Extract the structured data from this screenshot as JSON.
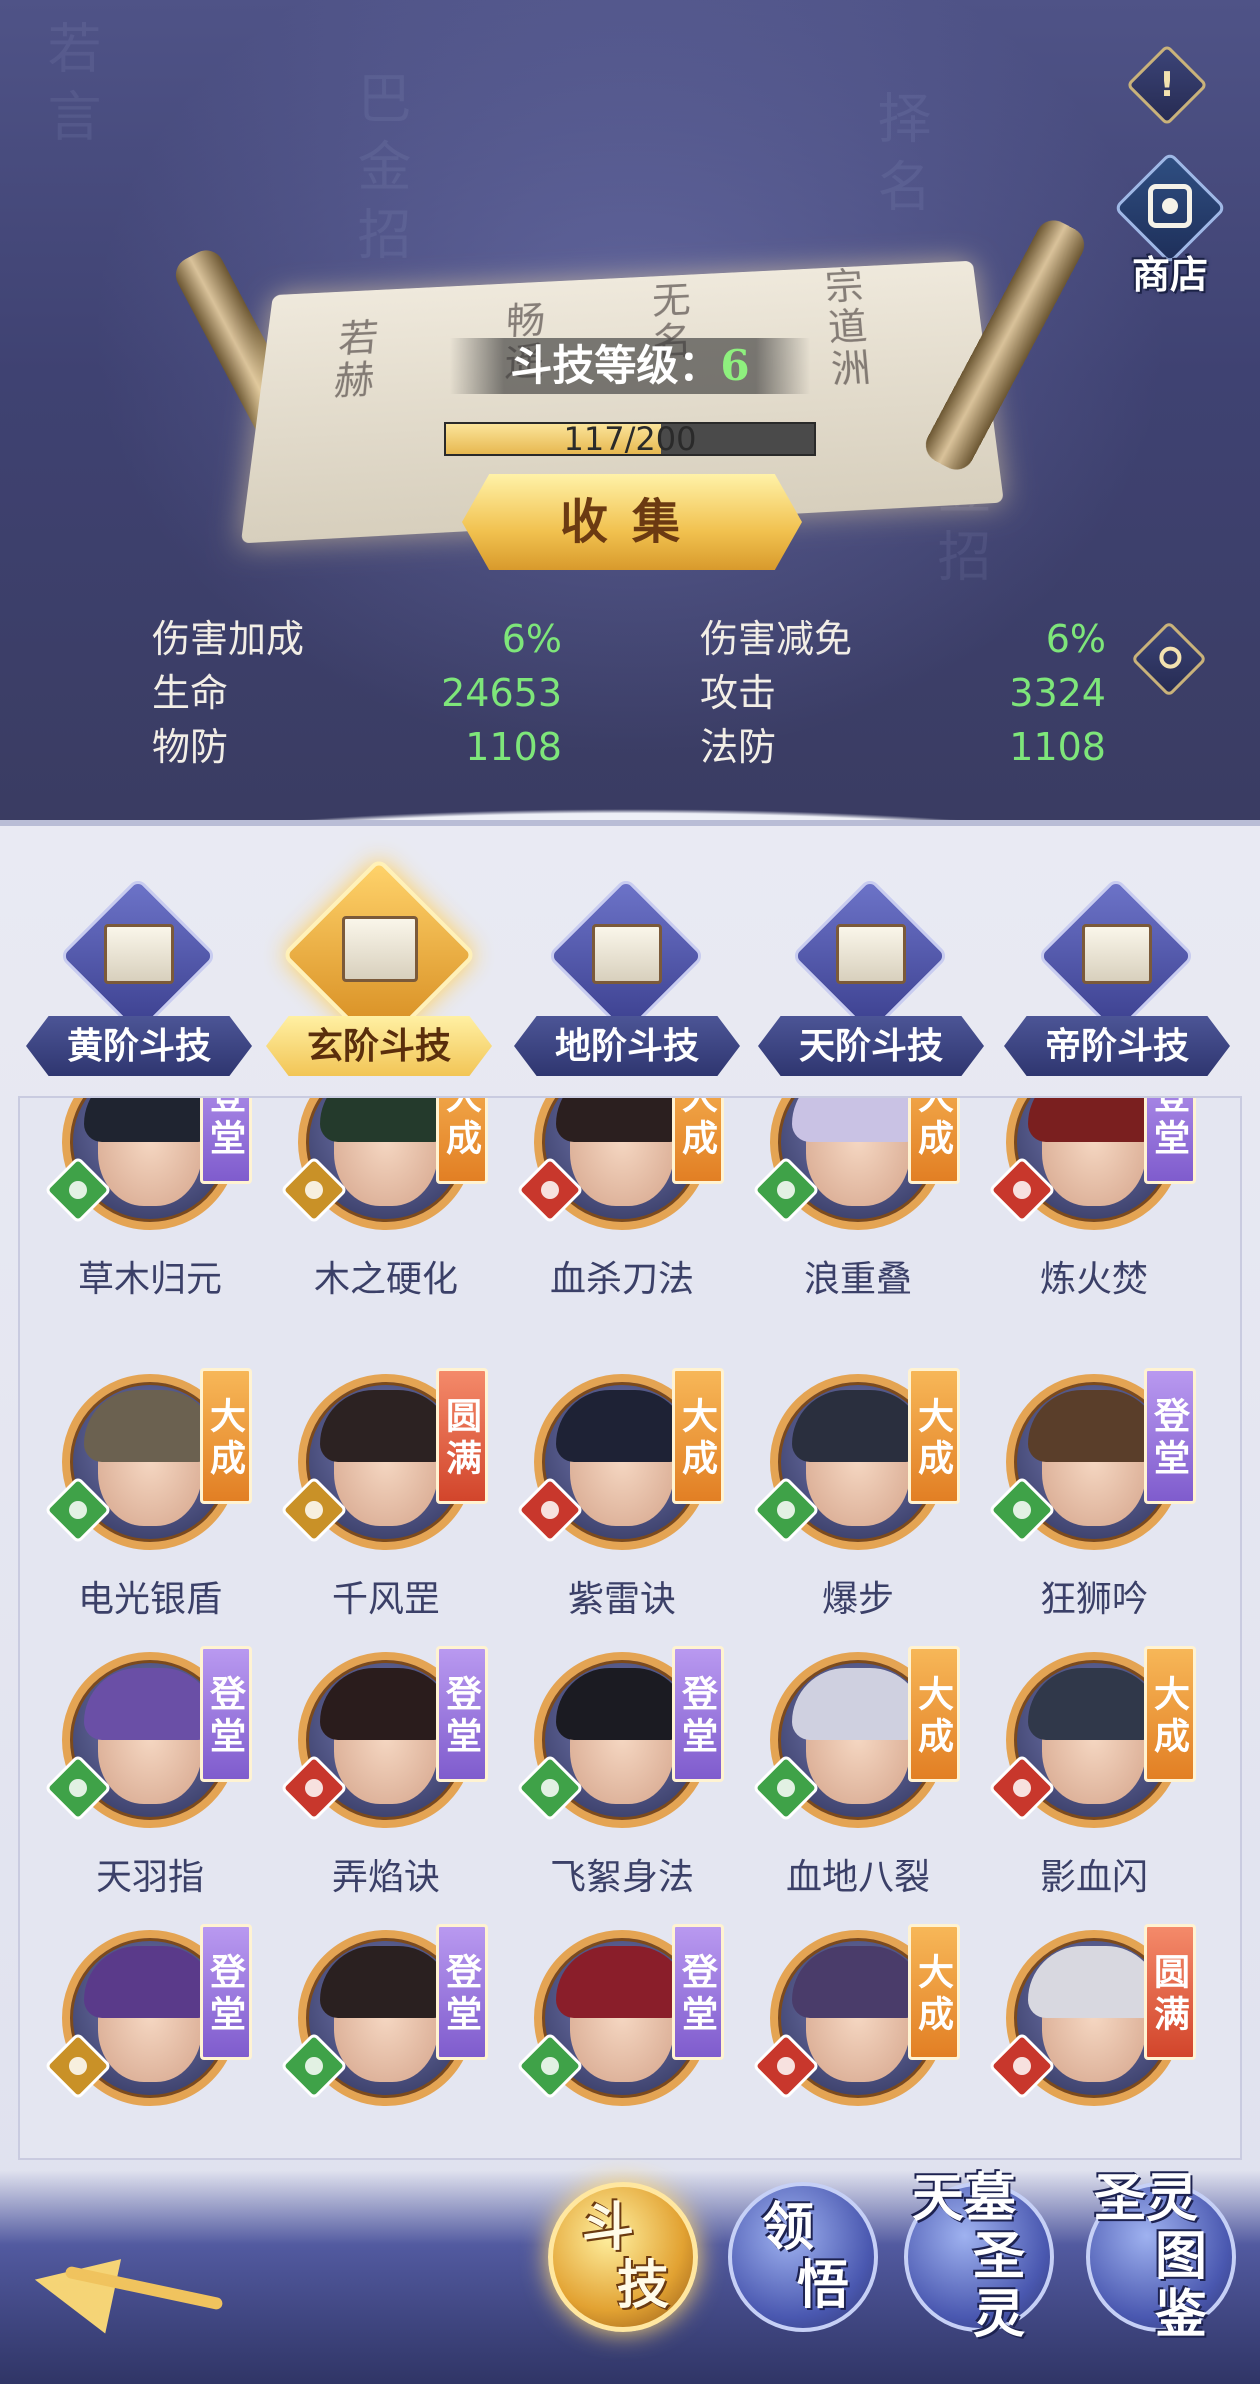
{
  "header": {
    "info_icon": "!",
    "shop_label": "商店"
  },
  "scroll": {
    "level_label": "斗技等级：",
    "level_value": "6",
    "exp_text": "117/200",
    "exp_fraction": 0.585,
    "collect_label": "收集"
  },
  "stats": {
    "damage_bonus": {
      "label": "伤害加成",
      "value": "6%"
    },
    "damage_reduction": {
      "label": "伤害减免",
      "value": "6%"
    },
    "hp": {
      "label": "生命",
      "value": "24653"
    },
    "attack": {
      "label": "攻击",
      "value": "3324"
    },
    "physical_def": {
      "label": "物防",
      "value": "1108"
    },
    "magic_def": {
      "label": "法防",
      "value": "1108"
    }
  },
  "tabs": [
    {
      "label": "黄阶斗技",
      "active": false
    },
    {
      "label": "玄阶斗技",
      "active": true
    },
    {
      "label": "地阶斗技",
      "active": false
    },
    {
      "label": "天阶斗技",
      "active": false
    },
    {
      "label": "帝阶斗技",
      "active": false
    }
  ],
  "skills": [
    {
      "name": "草木归元",
      "badge": "登堂",
      "element": "wood"
    },
    {
      "name": "木之硬化",
      "badge": "大成",
      "element": "gold"
    },
    {
      "name": "血杀刀法",
      "badge": "大成",
      "element": "fire"
    },
    {
      "name": "浪重叠",
      "badge": "大成",
      "element": "wood"
    },
    {
      "name": "炼火焚",
      "badge": "登堂",
      "element": "fire"
    },
    {
      "name": "电光银盾",
      "badge": "大成",
      "element": "wood"
    },
    {
      "name": "千风罡",
      "badge": "圆满",
      "element": "gold"
    },
    {
      "name": "紫雷诀",
      "badge": "大成",
      "element": "fire"
    },
    {
      "name": "爆步",
      "badge": "大成",
      "element": "wood"
    },
    {
      "name": "狂狮吟",
      "badge": "登堂",
      "element": "wood"
    },
    {
      "name": "天羽指",
      "badge": "登堂",
      "element": "wood"
    },
    {
      "name": "弄焰诀",
      "badge": "登堂",
      "element": "fire"
    },
    {
      "name": "飞絮身法",
      "badge": "登堂",
      "element": "wood"
    },
    {
      "name": "血地八裂",
      "badge": "大成",
      "element": "wood"
    },
    {
      "name": "影血闪",
      "badge": "大成",
      "element": "fire"
    },
    {
      "name": "",
      "badge": "登堂",
      "element": "gold"
    },
    {
      "name": "",
      "badge": "登堂",
      "element": "wood"
    },
    {
      "name": "",
      "badge": "登堂",
      "element": "wood"
    },
    {
      "name": "",
      "badge": "大成",
      "element": "fire"
    },
    {
      "name": "",
      "badge": "圆满",
      "element": "fire"
    }
  ],
  "bottom_nav": [
    {
      "line1": "斗",
      "line2": "技",
      "active": true
    },
    {
      "line1": "领",
      "line2": "悟",
      "active": false
    },
    {
      "line1": "天墓",
      "line2": "圣灵",
      "active": false
    },
    {
      "line1": "圣灵",
      "line2": "图鉴",
      "active": false
    }
  ],
  "colors": {
    "stat_value": "#7ee67a",
    "badge_dengtang": "#9a77e0",
    "badge_dacheng": "#ee9a3c",
    "badge_yuanman": "#e0603f"
  }
}
